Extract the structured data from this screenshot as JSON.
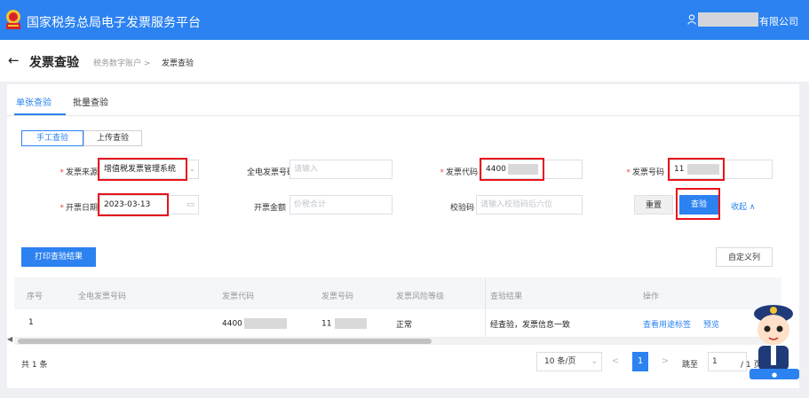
{
  "header": {
    "app_title": "国家税务总局电子发票服务平台",
    "user_suffix": "有限公司"
  },
  "page": {
    "title": "发票查验",
    "breadcrumb_parent": "税务数字账户",
    "breadcrumb_sep": ">",
    "breadcrumb_current": "发票查验"
  },
  "tabs": [
    {
      "label": "单张查验",
      "active": true
    },
    {
      "label": "批量查验",
      "active": false
    }
  ],
  "mode_tabs": [
    {
      "label": "手工查验",
      "active": true
    },
    {
      "label": "上传查验",
      "active": false
    }
  ],
  "form": {
    "source": {
      "label": "发票来源",
      "value": "增值税发票管理系统"
    },
    "fulldigit": {
      "label": "全电发票号码",
      "placeholder": "请输入"
    },
    "code": {
      "label": "发票代码",
      "value": "4400"
    },
    "number": {
      "label": "发票号码",
      "value": "11"
    },
    "date": {
      "label": "开票日期",
      "value": "2023-03-13"
    },
    "amount": {
      "label": "开票金额",
      "placeholder": "价税合计"
    },
    "checkcode": {
      "label": "校验码",
      "placeholder": "请输入校验码后六位"
    },
    "reset_label": "重置",
    "query_label": "查验",
    "collapse_label": "收起 ∧"
  },
  "toolbar": {
    "print_label": "打印查验结果",
    "custom_cols_label": "自定义列"
  },
  "table": {
    "headers": [
      "序号",
      "全电发票号码",
      "发票代码",
      "发票号码",
      "发票风险等级",
      "查验结果",
      "操作"
    ],
    "rows": [
      {
        "index": "1",
        "fulldigit": "",
        "code": "4400",
        "number": "11",
        "risk": "正常",
        "result": "经查验，发票信息一致",
        "action_tags": "查看用途标签",
        "action_preview": "预览"
      }
    ]
  },
  "pagination": {
    "total": "共 1 条",
    "page_size": "10 条/页",
    "prev": "<",
    "current": "1",
    "next": ">",
    "goto_label": "跳至",
    "goto_value": "1",
    "page_total": "/ 1 页"
  },
  "colors": {
    "primary": "#2b82f0",
    "highlight": "#e8131b"
  }
}
